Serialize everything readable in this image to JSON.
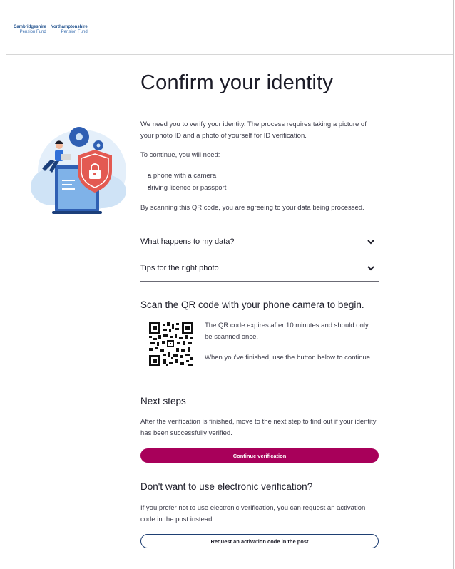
{
  "header": {
    "logo_left_line1": "Cambridgeshire",
    "logo_left_line2": "Pension Fund",
    "logo_right_line1": "Northamptonshire",
    "logo_right_line2": "Pension Fund"
  },
  "page": {
    "title": "Confirm your identity",
    "intro": "We need you to verify your identity. The process requires taking a picture of your photo ID and a photo of yourself for ID verification.",
    "need_label": "To continue, you will need:",
    "requirements": [
      "a phone with a camera",
      "driving licence or passport"
    ],
    "consent": "By scanning this QR code, you are agreeing to your data being processed."
  },
  "accordions": [
    {
      "label": "What happens to my data?"
    },
    {
      "label": "Tips for the right photo"
    }
  ],
  "qr_section": {
    "heading": "Scan the QR code with your phone camera to begin.",
    "expiry_text": "The QR code expires after 10 minutes and should only be scanned once.",
    "finished_text": "When you've finished, use the button below to continue."
  },
  "next_steps": {
    "heading": "Next steps",
    "text": "After the verification is finished, move to the next step to find out if your identity has been successfully verified.",
    "button_label": "Continue verification"
  },
  "alternative": {
    "heading": "Don't want to use electronic verification?",
    "text": "If you prefer not to use electronic verification, you can request an activation code in the post instead.",
    "button_label": "Request an activation code in the post"
  },
  "colors": {
    "primary_button": "#a8005a",
    "secondary_border": "#1e3f73",
    "shield": "#e35a52",
    "illustration_bg": "#d9e9f8"
  }
}
